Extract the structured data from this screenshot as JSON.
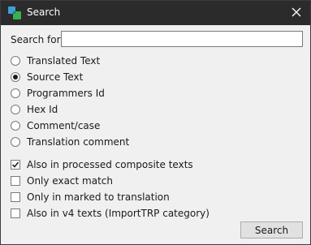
{
  "window": {
    "title": "Search",
    "titlebar_color": "#2b2b2b",
    "icons": {
      "app": "app-logo-icon",
      "close": "close-icon"
    }
  },
  "search": {
    "label": "Search for:",
    "value": "",
    "placeholder": ""
  },
  "target_options": [
    {
      "label": "Translated Text",
      "selected": false
    },
    {
      "label": "Source Text",
      "selected": true
    },
    {
      "label": "Programmers Id",
      "selected": false
    },
    {
      "label": "Hex Id",
      "selected": false
    },
    {
      "label": "Comment/case",
      "selected": false
    },
    {
      "label": "Translation comment",
      "selected": false
    }
  ],
  "filters": [
    {
      "label": "Also in processed composite texts",
      "checked": true
    },
    {
      "label": "Only exact match",
      "checked": false
    },
    {
      "label": "Only in marked to translation",
      "checked": false
    },
    {
      "label": "Also in v4 texts (ImportTRP category)",
      "checked": false
    }
  ],
  "buttons": {
    "search_label": "Search"
  }
}
